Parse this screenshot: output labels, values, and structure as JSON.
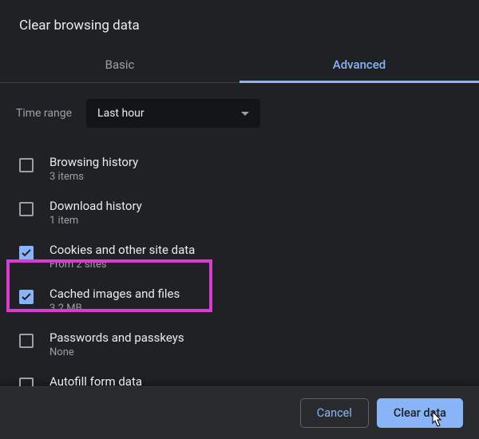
{
  "title": "Clear browsing data",
  "tabs": {
    "basic": "Basic",
    "advanced": "Advanced",
    "active": "advanced"
  },
  "timerange": {
    "label": "Time range",
    "value": "Last hour"
  },
  "options": [
    {
      "title": "Browsing history",
      "subtitle": "3 items",
      "checked": false
    },
    {
      "title": "Download history",
      "subtitle": "1 item",
      "checked": false
    },
    {
      "title": "Cookies and other site data",
      "subtitle": "From 2 sites",
      "checked": true
    },
    {
      "title": "Cached images and files",
      "subtitle": "3.2 MB",
      "checked": true,
      "highlighted": true
    },
    {
      "title": "Passwords and passkeys",
      "subtitle": "None",
      "checked": false
    },
    {
      "title": "Autofill form data",
      "subtitle": "",
      "checked": false
    }
  ],
  "buttons": {
    "cancel": "Cancel",
    "clear": "Clear data"
  },
  "colors": {
    "accent": "#8ab4f8",
    "highlight": "#d93ccf"
  }
}
